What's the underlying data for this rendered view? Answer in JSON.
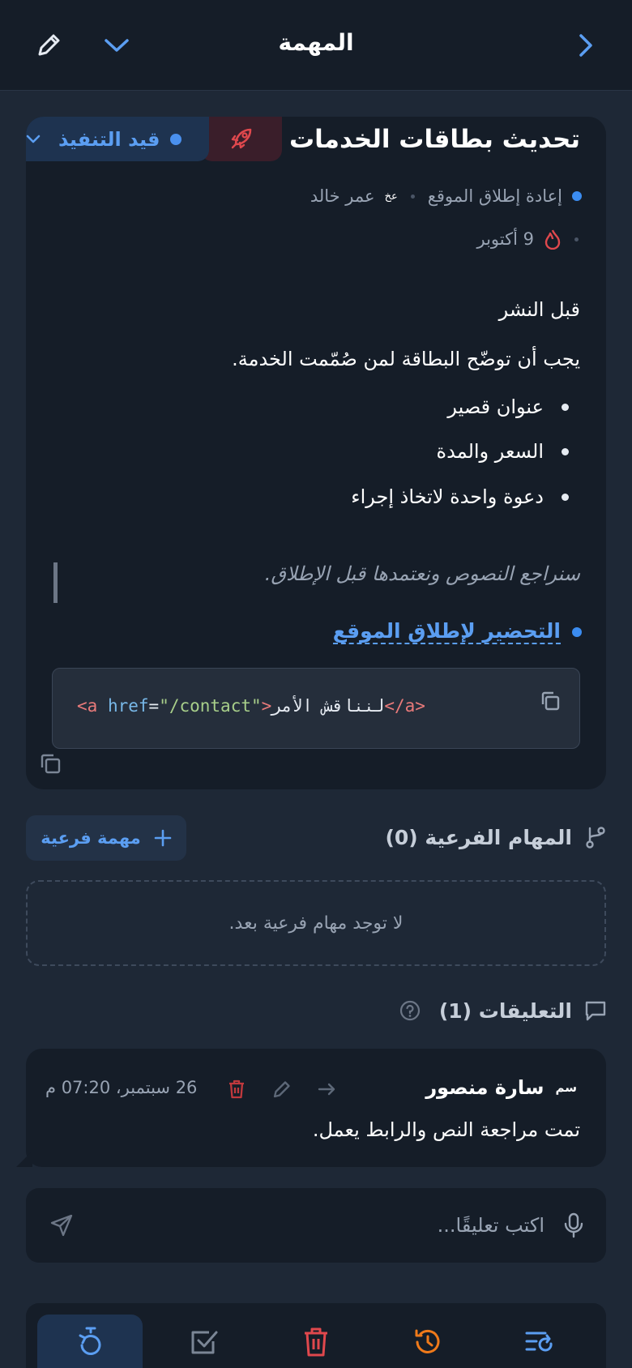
{
  "header": {
    "title": "المهمة"
  },
  "task": {
    "title": "تحديث بطاقات الخدمات",
    "status": "قيد التنفيذ",
    "project": "إعادة إطلاق الموقع",
    "assignee_initials": "عخ",
    "assignee": "عمر خالد",
    "due_date": "9 أكتوبر"
  },
  "description": {
    "heading": "قبل النشر",
    "paragraph": "يجب أن توضّح البطاقة لمن صُمّمت الخدمة.",
    "bullets": [
      "عنوان قصير",
      "السعر والمدة",
      "دعوة واحدة لاتخاذ إجراء"
    ],
    "quote": "سنراجع النصوص ونعتمدها قبل الإطلاق.",
    "link": "التحضير لإطلاق الموقع",
    "code": {
      "open_tag": "<a",
      "attr": "href",
      "eq": "=",
      "value": "\"/contact\"",
      "close_open": ">",
      "text": "لنناقش الأمر",
      "close_tag": "</a>"
    }
  },
  "subtasks": {
    "heading": "المهام الفرعية (0)",
    "add_label": "مهمة فرعية",
    "empty": "لا توجد مهام فرعية بعد."
  },
  "comments": {
    "heading": "التعليقات (1)",
    "items": [
      {
        "initials": "سم",
        "author": "سارة منصور",
        "time": "26 سبتمبر، 07:20 م",
        "text": "تمت مراجعة النص والرابط يعمل."
      }
    ],
    "input_placeholder": "اكتب تعليقًا..."
  },
  "colors": {
    "accent": "#5b9ef2",
    "danger": "#e0484d",
    "warning": "#f07a1a",
    "background": "#1e2836",
    "card": "#151d28"
  }
}
